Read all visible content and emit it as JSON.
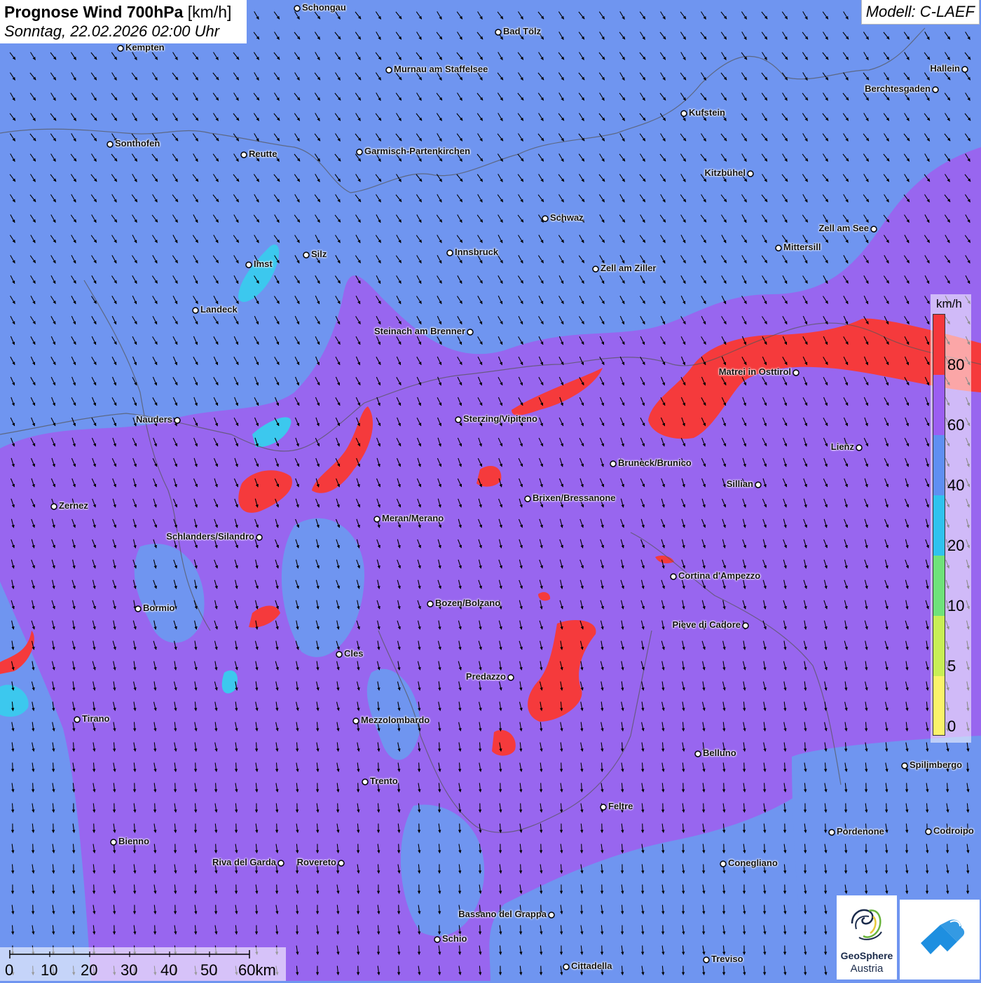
{
  "title": {
    "main": "Prognose Wind 700hPa",
    "unit": "[km/h]",
    "datetime": "Sonntag, 22.02.2026 02:00 Uhr"
  },
  "model": "Modell: C-LAEF",
  "legend": {
    "unit": "km/h",
    "labels": [
      "80",
      "60",
      "40",
      "20",
      "10",
      "5",
      "0"
    ],
    "colors": {
      "80plus": "#f5373b",
      "60to80": "#9b5ef2",
      "40to60": "#5f8ff2",
      "20to40": "#2fc2ee",
      "10to20": "#6fe27a",
      "5to10": "#c8ee55",
      "0to5": "#fbf36a"
    }
  },
  "scale": {
    "labels": [
      "0",
      "10",
      "20",
      "30",
      "40",
      "50",
      "60km"
    ]
  },
  "cities": [
    {
      "name": "Schongau"
    },
    {
      "name": "Bad Tölz"
    },
    {
      "name": "Kempten"
    },
    {
      "name": "Murnau am Staffelsee"
    },
    {
      "name": "Hallein"
    },
    {
      "name": "Berchtesgaden"
    },
    {
      "name": "Kufstein"
    },
    {
      "name": "Sonthofen"
    },
    {
      "name": "Reutte"
    },
    {
      "name": "Garmisch-Partenkirchen"
    },
    {
      "name": "Kitzbühel"
    },
    {
      "name": "Schwaz"
    },
    {
      "name": "Zell am See"
    },
    {
      "name": "Mittersill"
    },
    {
      "name": "Innsbruck"
    },
    {
      "name": "Silz"
    },
    {
      "name": "Imst"
    },
    {
      "name": "Zell am Ziller"
    },
    {
      "name": "Landeck"
    },
    {
      "name": "Steinach am Brenner"
    },
    {
      "name": "Matrei in Osttirol"
    },
    {
      "name": "Nauders"
    },
    {
      "name": "Sterzing/Vipiteno"
    },
    {
      "name": "Lienz"
    },
    {
      "name": "Bruneck/Brunico"
    },
    {
      "name": "Sillian"
    },
    {
      "name": "Zernez"
    },
    {
      "name": "Brixen/Bressanone"
    },
    {
      "name": "Meran/Merano"
    },
    {
      "name": "Schlanders/Silandro"
    },
    {
      "name": "Cortina d'Ampezzo"
    },
    {
      "name": "Bormio"
    },
    {
      "name": "Bozen/Bolzano"
    },
    {
      "name": "Pieve di Cadore"
    },
    {
      "name": "Cles"
    },
    {
      "name": "Predazzo"
    },
    {
      "name": "Tirano"
    },
    {
      "name": "Mezzolombardo"
    },
    {
      "name": "Belluno"
    },
    {
      "name": "Spilimbergo"
    },
    {
      "name": "Trento"
    },
    {
      "name": "Feltre"
    },
    {
      "name": "Pordenone"
    },
    {
      "name": "Codroipo"
    },
    {
      "name": "Bienno"
    },
    {
      "name": "Riva del Garda"
    },
    {
      "name": "Rovereto"
    },
    {
      "name": "Conegliano"
    },
    {
      "name": "Bassano del Grappa"
    },
    {
      "name": "Schio"
    },
    {
      "name": "Treviso"
    },
    {
      "name": "Cittadella"
    }
  ],
  "logos": {
    "geosphere_name": "GeoSphere",
    "geosphere_sub": "Austria"
  }
}
